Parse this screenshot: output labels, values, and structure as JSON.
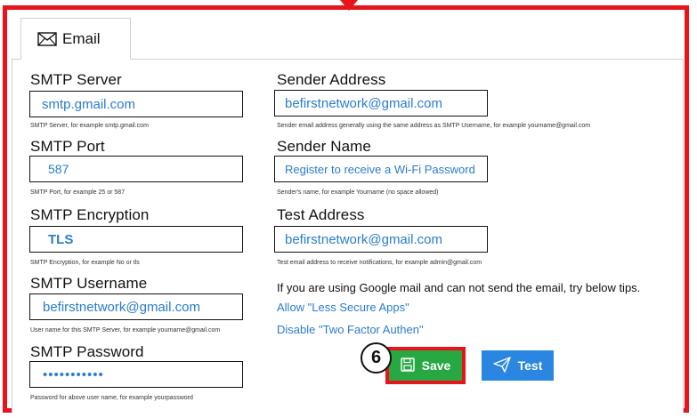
{
  "tab": {
    "label": "Email",
    "icon": "envelope-icon"
  },
  "left": {
    "smtp_server": {
      "label": "SMTP Server",
      "value": "smtp.gmail.com",
      "hint": "SMTP Server, for example smtp.gmail.com"
    },
    "smtp_port": {
      "label": "SMTP Port",
      "value": "587",
      "hint": "SMTP Port, for example 25 or 587"
    },
    "smtp_encryption": {
      "label": "SMTP Encryption",
      "value": "TLS",
      "hint": "SMTP Encryption, for example No or tls"
    },
    "smtp_username": {
      "label": "SMTP Username",
      "value": "befirstnetwork@gmail.com",
      "hint": "User name for this SMTP Server, for example yourname@gmail.com"
    },
    "smtp_password": {
      "label": "SMTP Password",
      "value": "•••••••••••",
      "hint": "Password for above user name, for example yourpassword"
    }
  },
  "right": {
    "sender_address": {
      "label": "Sender Address",
      "value": "befirstnetwork@gmail.com",
      "hint": "Sender email address generally using the same address as SMTP Username, for example yourname@gmail.com"
    },
    "sender_name": {
      "label": "Sender Name",
      "value": "Register to receive a Wi-Fi Password",
      "hint": "Sender's name, for example Yourname (no space allowed)"
    },
    "test_address": {
      "label": "Test Address",
      "value": "befirstnetwork@gmail.com",
      "hint": "Test email address to receive notifications, for example admin@gmail.com"
    }
  },
  "tips": {
    "text": "If you are using Google mail and can not send the email, try below tips.",
    "link1": "Allow \"Less Secure Apps\"",
    "link2": "Disable \"Two Factor Authen\""
  },
  "buttons": {
    "save": "Save",
    "test": "Test"
  },
  "annotation": {
    "step": "6"
  },
  "colors": {
    "annotation_red": "#e8141b",
    "save_green": "#27a843",
    "test_blue": "#2a86e0",
    "value_blue": "#2a7ccf"
  }
}
